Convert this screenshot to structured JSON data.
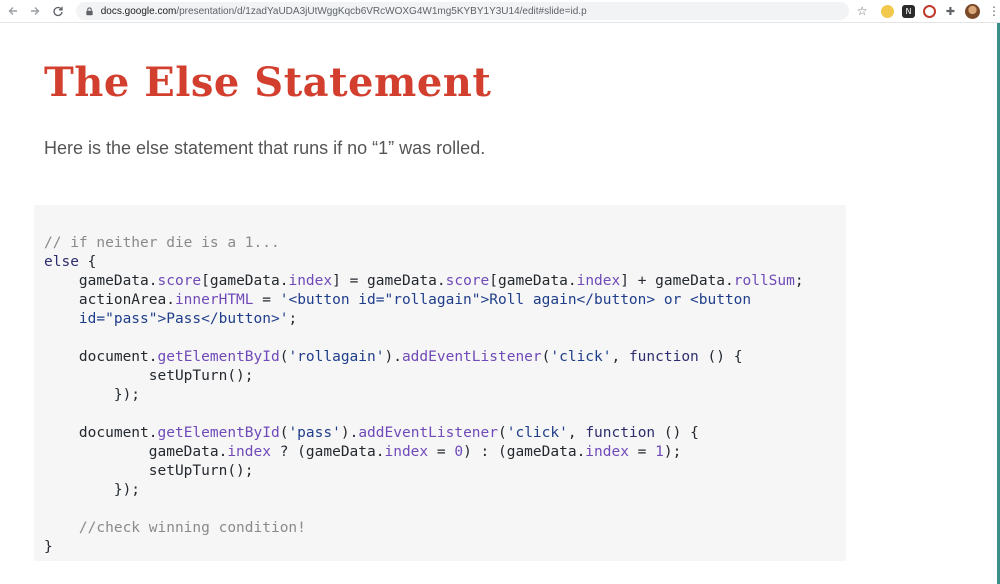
{
  "browser": {
    "url_host": "docs.google.com",
    "url_path": "/presentation/d/1zadYaUDA3jUtWggKqcb6VRcWOXG4W1mg5KYBY1Y3U14/edit#slide=id.p",
    "back_icon": "back-arrow-icon",
    "forward_icon": "forward-arrow-icon",
    "reload_icon": "reload-icon",
    "lock_icon": "lock-icon",
    "bookmark_icon": "star-icon",
    "menu_icon": "kebab-menu-icon"
  },
  "slide": {
    "title": "The Else Statement",
    "subtitle": "Here is the else statement that runs if no “1” was rolled.",
    "title_color": "#d33f2e",
    "accent_strip_color": "#3a8f8a",
    "code_lines": [
      [
        {
          "t": "// if neither die is a 1...",
          "c": "comment"
        }
      ],
      [
        {
          "t": "else",
          "c": "keyword"
        },
        {
          "t": " {",
          "c": "plain"
        }
      ],
      [
        {
          "t": "    gameData.",
          "c": "plain"
        },
        {
          "t": "score",
          "c": "prop"
        },
        {
          "t": "[gameData.",
          "c": "plain"
        },
        {
          "t": "index",
          "c": "prop"
        },
        {
          "t": "] = gameData.",
          "c": "plain"
        },
        {
          "t": "score",
          "c": "prop"
        },
        {
          "t": "[gameData.",
          "c": "plain"
        },
        {
          "t": "index",
          "c": "prop"
        },
        {
          "t": "] + gameData.",
          "c": "plain"
        },
        {
          "t": "rollSum",
          "c": "prop"
        },
        {
          "t": ";",
          "c": "plain"
        }
      ],
      [
        {
          "t": "    actionArea.",
          "c": "plain"
        },
        {
          "t": "innerHTML",
          "c": "prop"
        },
        {
          "t": " = ",
          "c": "plain"
        },
        {
          "t": "'<button id=\"rollagain\">Roll again</button> or <button",
          "c": "string"
        }
      ],
      [
        {
          "t": "    id=\"pass\">Pass</button>'",
          "c": "string"
        },
        {
          "t": ";",
          "c": "plain"
        }
      ],
      [
        {
          "t": "",
          "c": "plain"
        }
      ],
      [
        {
          "t": "    document.",
          "c": "plain"
        },
        {
          "t": "getElementById",
          "c": "prop"
        },
        {
          "t": "(",
          "c": "plain"
        },
        {
          "t": "'rollagain'",
          "c": "string"
        },
        {
          "t": ").",
          "c": "plain"
        },
        {
          "t": "addEventListener",
          "c": "prop"
        },
        {
          "t": "(",
          "c": "plain"
        },
        {
          "t": "'click'",
          "c": "string"
        },
        {
          "t": ", ",
          "c": "plain"
        },
        {
          "t": "function",
          "c": "keyword"
        },
        {
          "t": " () {",
          "c": "plain"
        }
      ],
      [
        {
          "t": "            setUpTurn();",
          "c": "plain"
        }
      ],
      [
        {
          "t": "        });",
          "c": "plain"
        }
      ],
      [
        {
          "t": "",
          "c": "plain"
        }
      ],
      [
        {
          "t": "    document.",
          "c": "plain"
        },
        {
          "t": "getElementById",
          "c": "prop"
        },
        {
          "t": "(",
          "c": "plain"
        },
        {
          "t": "'pass'",
          "c": "string"
        },
        {
          "t": ").",
          "c": "plain"
        },
        {
          "t": "addEventListener",
          "c": "prop"
        },
        {
          "t": "(",
          "c": "plain"
        },
        {
          "t": "'click'",
          "c": "string"
        },
        {
          "t": ", ",
          "c": "plain"
        },
        {
          "t": "function",
          "c": "keyword"
        },
        {
          "t": " () {",
          "c": "plain"
        }
      ],
      [
        {
          "t": "            gameData.",
          "c": "plain"
        },
        {
          "t": "index",
          "c": "prop"
        },
        {
          "t": " ? (gameData.",
          "c": "plain"
        },
        {
          "t": "index",
          "c": "prop"
        },
        {
          "t": " = ",
          "c": "plain"
        },
        {
          "t": "0",
          "c": "number"
        },
        {
          "t": ") : (gameData.",
          "c": "plain"
        },
        {
          "t": "index",
          "c": "prop"
        },
        {
          "t": " = ",
          "c": "plain"
        },
        {
          "t": "1",
          "c": "number"
        },
        {
          "t": ");",
          "c": "plain"
        }
      ],
      [
        {
          "t": "            setUpTurn();",
          "c": "plain"
        }
      ],
      [
        {
          "t": "        });",
          "c": "plain"
        }
      ],
      [
        {
          "t": "",
          "c": "plain"
        }
      ],
      [
        {
          "t": "    //check winning condition!",
          "c": "comment"
        }
      ],
      [
        {
          "t": "}",
          "c": "plain"
        }
      ]
    ]
  }
}
